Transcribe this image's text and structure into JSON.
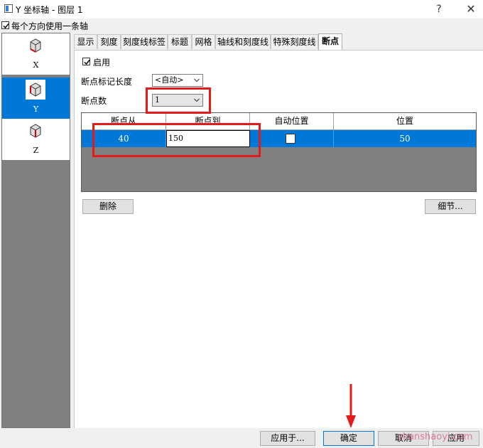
{
  "window": {
    "title": "Y 坐标轴 - 图层 1",
    "help": "?",
    "close": "✕"
  },
  "one_axis_per_direction": {
    "label": "每个方向使用一条轴",
    "checked": true
  },
  "axes": [
    {
      "label": "X",
      "selected": false,
      "icon": "axis-cube-icon"
    },
    {
      "label": "Y",
      "selected": true,
      "icon": "axis-cube-icon"
    },
    {
      "label": "Z",
      "selected": false,
      "icon": "axis-cube-icon"
    }
  ],
  "tabs": [
    "显示",
    "刻度",
    "刻度线标签",
    "标题",
    "网格",
    "轴线和刻度线",
    "特殊刻度线",
    "断点"
  ],
  "active_tab": "断点",
  "break": {
    "enable_label": "启用",
    "enable_checked": true,
    "mark_length_label": "断点标记长度",
    "mark_length_value": "<自动>",
    "count_label": "断点数",
    "count_value": "1"
  },
  "grid": {
    "headers": [
      "断点从",
      "断点到",
      "自动位置",
      "位置"
    ],
    "rows": [
      {
        "from": "40",
        "to": "150",
        "auto": false,
        "position": "50"
      }
    ]
  },
  "buttons": {
    "delete": "删除",
    "details": "细节...",
    "apply_to": "应用于...",
    "ok": "确定",
    "cancel": "取消",
    "apply": "应用"
  },
  "watermark": "zhanshaoyi.com",
  "colors": {
    "selection": "#0078d7",
    "annotation": "#e21a1a"
  }
}
